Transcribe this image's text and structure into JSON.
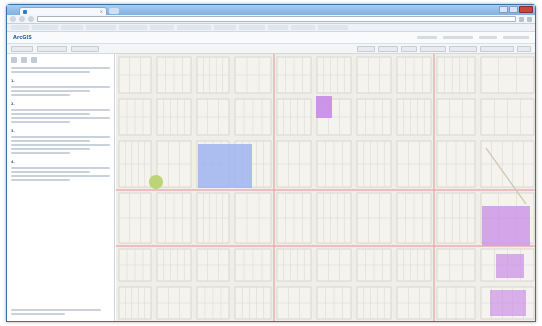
{
  "browser": {
    "tab_title": "",
    "url": "",
    "bookmarks": [
      "",
      "",
      "",
      "",
      "",
      "",
      "",
      "",
      "",
      "",
      "",
      ""
    ]
  },
  "app": {
    "brand": "ArcGIS",
    "map_title": "",
    "header_links": [
      "",
      "",
      "",
      ""
    ]
  },
  "toolbar": {
    "left_buttons": [
      "",
      "",
      ""
    ],
    "right_buttons": [
      "",
      "",
      "",
      "",
      "",
      "",
      ""
    ]
  },
  "sidebar": {
    "steps": [
      {
        "num": "1."
      },
      {
        "num": "2."
      },
      {
        "num": "3."
      },
      {
        "num": "4."
      }
    ]
  },
  "map": {
    "highlight_colors": {
      "selected_area": "#9fb3ef",
      "parcel_purple": "#c98be6",
      "parcel_green": "#b6d26a"
    },
    "basemap_color": "#efeee8"
  }
}
